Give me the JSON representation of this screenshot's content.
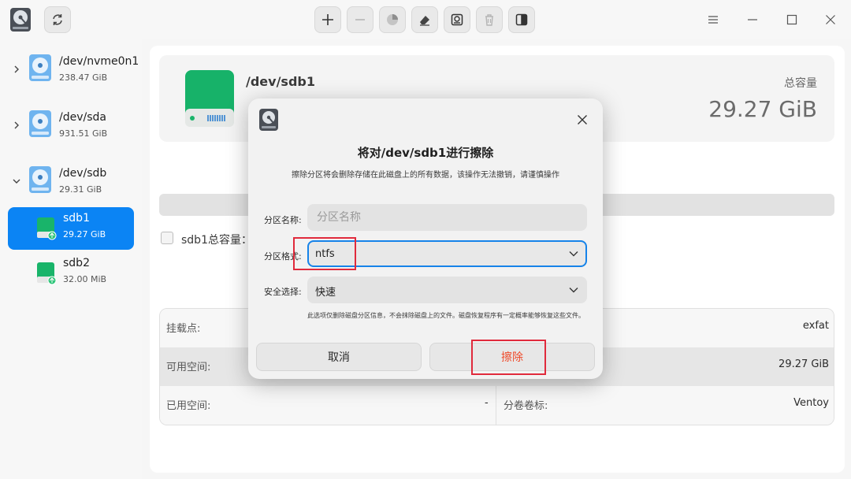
{
  "toolbar": {
    "refresh": "refresh-icon",
    "actions": [
      "add-icon",
      "remove-icon",
      "pie-chart-icon",
      "eraser-icon",
      "disk-icon",
      "trash-icon",
      "split-icon"
    ]
  },
  "sidebar": {
    "devices": [
      {
        "name": "/dev/nvme0n1",
        "size": "238.47 GiB",
        "expanded": false
      },
      {
        "name": "/dev/sda",
        "size": "931.51 GiB",
        "expanded": false
      },
      {
        "name": "/dev/sdb",
        "size": "29.31 GiB",
        "expanded": true
      }
    ],
    "partitions": [
      {
        "name": "sdb1",
        "size": "29.27 GiB",
        "selected": true
      },
      {
        "name": "sdb2",
        "size": "32.00 MiB",
        "selected": false
      }
    ]
  },
  "main": {
    "title": "/dev/sdb1",
    "capacity_label": "总容量",
    "capacity_value": "29.27 GiB",
    "usage_fraction": 0,
    "legend_label": "sdb1总容量：",
    "info": {
      "mount_label": "挂载点:",
      "fs_value": "exfat",
      "free_label": "可用空间:",
      "free_value": "29.27 GiB",
      "used_label": "已用空间:",
      "used_value": "-",
      "volume_label": "分卷卷标:",
      "volume_value": "Ventoy"
    }
  },
  "dialog": {
    "title": "将对/dev/sdb1进行擦除",
    "warning": "擦除分区将会删除存储在此磁盘上的所有数据，该操作无法撤销，请谨慎操作",
    "name_label": "分区名称:",
    "name_placeholder": "分区名称",
    "name_value": "",
    "format_label": "分区格式:",
    "format_value": "ntfs",
    "security_label": "安全选择:",
    "security_value": "快速",
    "note": "此选项仅删除磁盘分区信息，不会抹除磁盘上的文件。磁盘恢复程序有一定概率能够恢复这些文件。",
    "cancel_label": "取消",
    "erase_label": "擦除"
  },
  "colors": {
    "accent": "#0b84f4",
    "danger_text": "#ef4a2a",
    "highlight": "#e02a3c"
  }
}
